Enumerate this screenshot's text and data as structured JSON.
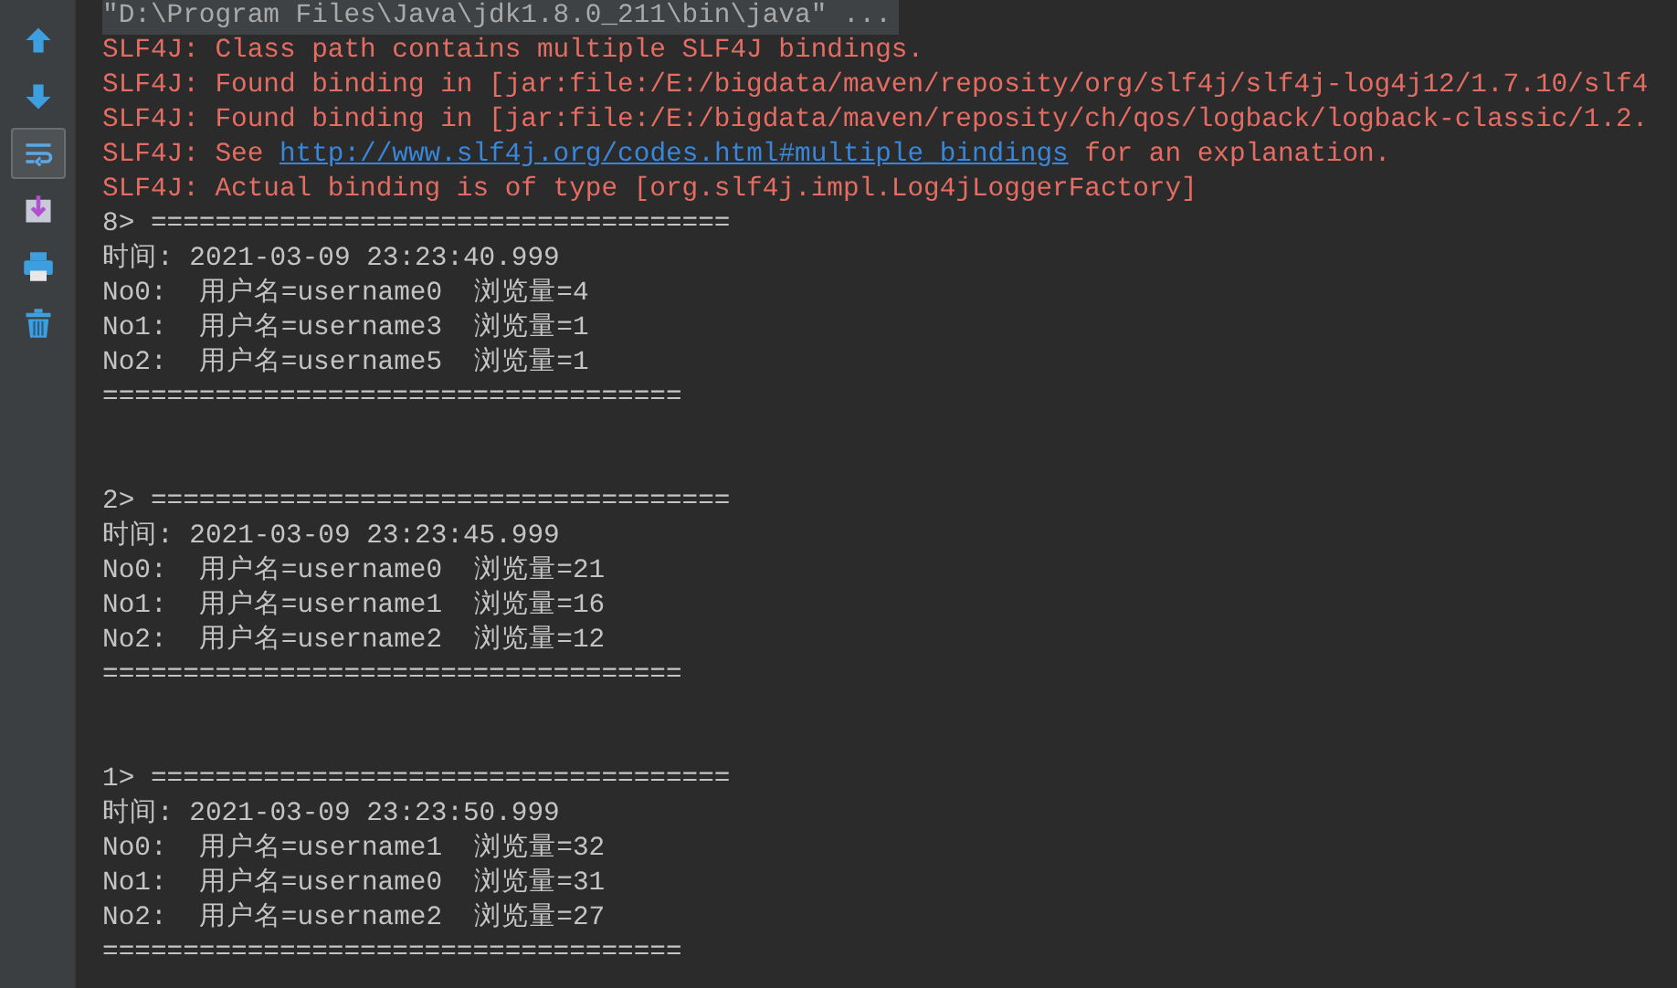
{
  "toolbar": [
    {
      "kind": "up",
      "selected": false
    },
    {
      "kind": "down",
      "selected": false
    },
    {
      "kind": "wrap",
      "selected": true
    },
    {
      "kind": "scroll",
      "selected": false
    },
    {
      "kind": "print",
      "selected": false
    },
    {
      "kind": "trash",
      "selected": false
    }
  ],
  "console": {
    "lines": [
      {
        "kind": "command",
        "text": "\"D:\\Program Files\\Java\\jdk1.8.0_211\\bin\\java\" ..."
      },
      {
        "kind": "error",
        "text": "SLF4J: Class path contains multiple SLF4J bindings."
      },
      {
        "kind": "error",
        "text": "SLF4J: Found binding in [jar:file:/E:/bigdata/maven/reposity/org/slf4j/slf4j-log4j12/1.7.10/slf4"
      },
      {
        "kind": "error",
        "text": "SLF4J: Found binding in [jar:file:/E:/bigdata/maven/reposity/ch/qos/logback/logback-classic/1.2."
      },
      {
        "kind": "error_link",
        "text": "SLF4J: See ",
        "link": "http://www.slf4j.org/codes.html#multiple_bindings",
        "suffix": " for an explanation."
      },
      {
        "kind": "error",
        "text": "SLF4J: Actual binding is of type [org.slf4j.impl.Log4jLoggerFactory]"
      },
      {
        "kind": "output",
        "text": "8> ===================================="
      },
      {
        "kind": "output",
        "text": "时间: 2021-03-09 23:23:40.999"
      },
      {
        "kind": "output",
        "text": "No0:  用户名=username0  浏览量=4"
      },
      {
        "kind": "output",
        "text": "No1:  用户名=username3  浏览量=1"
      },
      {
        "kind": "output",
        "text": "No2:  用户名=username5  浏览量=1"
      },
      {
        "kind": "output",
        "text": "===================================="
      },
      {
        "kind": "blank"
      },
      {
        "kind": "blank"
      },
      {
        "kind": "output",
        "text": "2> ===================================="
      },
      {
        "kind": "output",
        "text": "时间: 2021-03-09 23:23:45.999"
      },
      {
        "kind": "output",
        "text": "No0:  用户名=username0  浏览量=21"
      },
      {
        "kind": "output",
        "text": "No1:  用户名=username1  浏览量=16"
      },
      {
        "kind": "output",
        "text": "No2:  用户名=username2  浏览量=12"
      },
      {
        "kind": "output",
        "text": "===================================="
      },
      {
        "kind": "blank"
      },
      {
        "kind": "blank"
      },
      {
        "kind": "output",
        "text": "1> ===================================="
      },
      {
        "kind": "output",
        "text": "时间: 2021-03-09 23:23:50.999"
      },
      {
        "kind": "output",
        "text": "No0:  用户名=username1  浏览量=32"
      },
      {
        "kind": "output",
        "text": "No1:  用户名=username0  浏览量=31"
      },
      {
        "kind": "output",
        "text": "No2:  用户名=username2  浏览量=27"
      },
      {
        "kind": "output",
        "text": "===================================="
      }
    ]
  }
}
